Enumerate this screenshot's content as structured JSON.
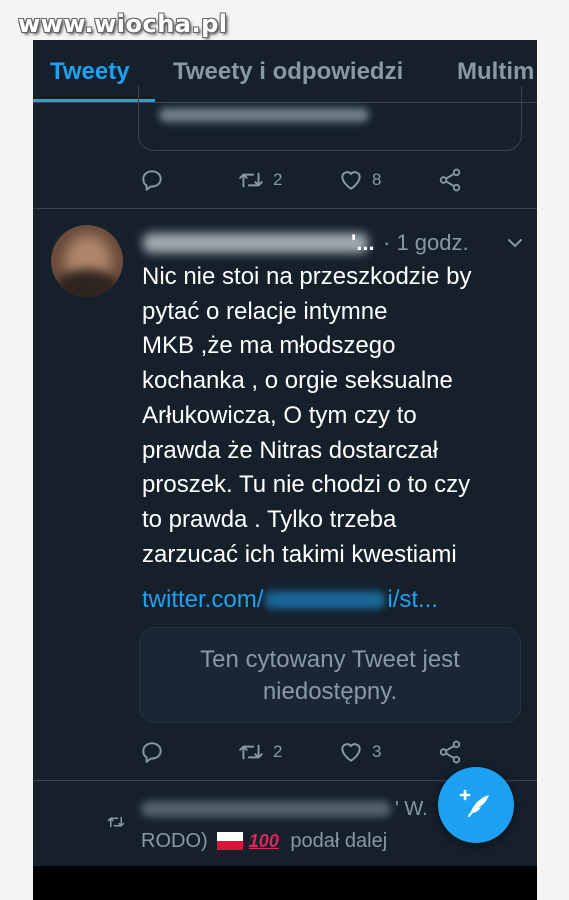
{
  "watermark": "www.wiocha.pl",
  "tabs": [
    {
      "label": "Tweety",
      "active": true
    },
    {
      "label": "Tweety i odpowiedzi",
      "active": false
    },
    {
      "label": "Multim",
      "active": false
    }
  ],
  "prev_tweet": {
    "retweets": "2",
    "likes": "8"
  },
  "tweet": {
    "name_suffix": "'...",
    "time": "· 1 godz.",
    "text": "Nic nie stoi na przeszkodzie by\npytać o relacje intymne\nMKB ,że ma młodszego\nkochanka ,  o orgie seksualne\nArłukowicza, O tym czy to\nprawda że Nitras dostarczał\nproszek. Tu nie chodzi o to czy\nto prawda . Tylko trzeba\nzarzucać ich takimi kwestiami",
    "link_start": "twitter.com/",
    "link_end": "i/st...",
    "quote_text": "Ten cytowany Tweet jest niedostępny.",
    "retweets": "2",
    "likes": "3"
  },
  "retweet_banner": {
    "line1_end": "' W.",
    "line2_start": "RODO)",
    "hundred": "100",
    "line2_end": "podał dalej"
  },
  "colors": {
    "background": "#15202b",
    "accent": "#1da1f2",
    "secondary_text": "#8899a6",
    "divider": "#38444d"
  },
  "icons": [
    "reply-icon",
    "retweet-icon",
    "heart-icon",
    "share-icon",
    "chevron-down-icon",
    "compose-tweet-icon",
    "poland-flag-icon"
  ]
}
